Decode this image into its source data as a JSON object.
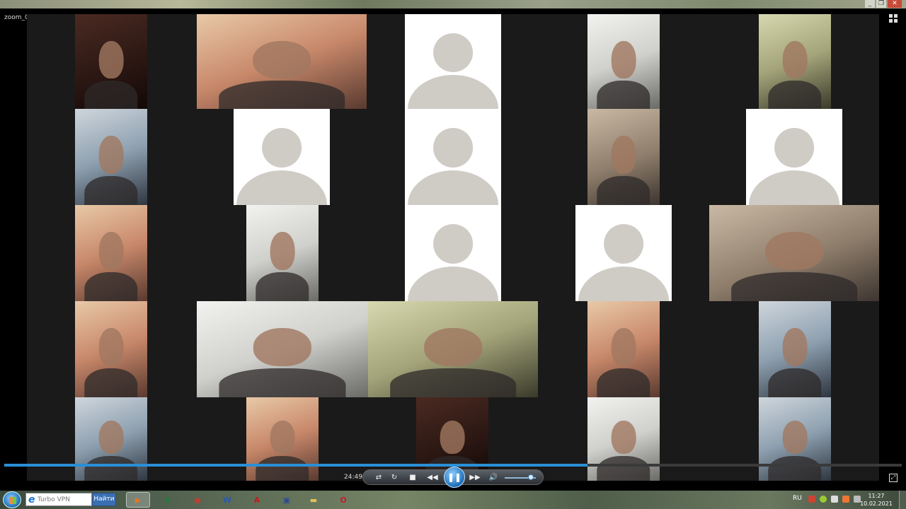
{
  "window": {
    "title": "zoom_0",
    "controls": [
      "minimize-icon",
      "restore-icon",
      "close-icon"
    ]
  },
  "gallery": {
    "tiles": [
      {
        "kind": "video",
        "tone": "dark"
      },
      {
        "kind": "video",
        "tone": "warm"
      },
      {
        "kind": "avatar"
      },
      {
        "kind": "video",
        "tone": "white"
      },
      {
        "kind": "video",
        "tone": "green"
      },
      {
        "kind": "video",
        "tone": "blue"
      },
      {
        "kind": "avatar"
      },
      {
        "kind": "avatar"
      },
      {
        "kind": "video",
        "tone": "cam"
      },
      {
        "kind": "avatar"
      },
      {
        "kind": "video",
        "tone": "warm"
      },
      {
        "kind": "video",
        "tone": "white"
      },
      {
        "kind": "avatar"
      },
      {
        "kind": "avatar"
      },
      {
        "kind": "video",
        "tone": "cam"
      },
      {
        "kind": "video",
        "tone": "warm"
      },
      {
        "kind": "video",
        "tone": "white"
      },
      {
        "kind": "video",
        "tone": "green"
      },
      {
        "kind": "video",
        "tone": "warm"
      },
      {
        "kind": "video",
        "tone": "blue"
      },
      {
        "kind": "video",
        "tone": "blue"
      },
      {
        "kind": "video",
        "tone": "warm"
      },
      {
        "kind": "video",
        "tone": "dark"
      },
      {
        "kind": "video",
        "tone": "white"
      },
      {
        "kind": "video",
        "tone": "blue"
      }
    ]
  },
  "player": {
    "elapsed": "24:49",
    "progress_fraction": 0.65,
    "volume_fraction": 0.85,
    "buttons": {
      "shuffle": "⇄",
      "repeat": "↻",
      "stop": "■",
      "prev": "◀◀",
      "play_pause": "❚❚",
      "next": "▶▶",
      "volume": "🔊"
    }
  },
  "taskbar": {
    "search_placeholder": "Turbo VPN",
    "search_button": "Найти",
    "apps": [
      {
        "name": "media-player-icon",
        "glyph": "▶",
        "color": "#e07a1f",
        "active": true
      },
      {
        "name": "excel-icon",
        "glyph": "X",
        "color": "#1e7a3c",
        "active": false
      },
      {
        "name": "chrome-icon",
        "glyph": "◉",
        "color": "#d9342b",
        "active": false
      },
      {
        "name": "word-icon",
        "glyph": "W",
        "color": "#2a5caa",
        "active": false
      },
      {
        "name": "acrobat-icon",
        "glyph": "A",
        "color": "#c21d1d",
        "active": false
      },
      {
        "name": "save-icon",
        "glyph": "▣",
        "color": "#2a4a9a",
        "active": false
      },
      {
        "name": "folder-icon",
        "glyph": "▬",
        "color": "#e3c15a",
        "active": false
      },
      {
        "name": "opera-icon",
        "glyph": "O",
        "color": "#d1182c",
        "active": false
      }
    ],
    "language": "RU",
    "time": "11:27",
    "date": "10.02.2021"
  }
}
